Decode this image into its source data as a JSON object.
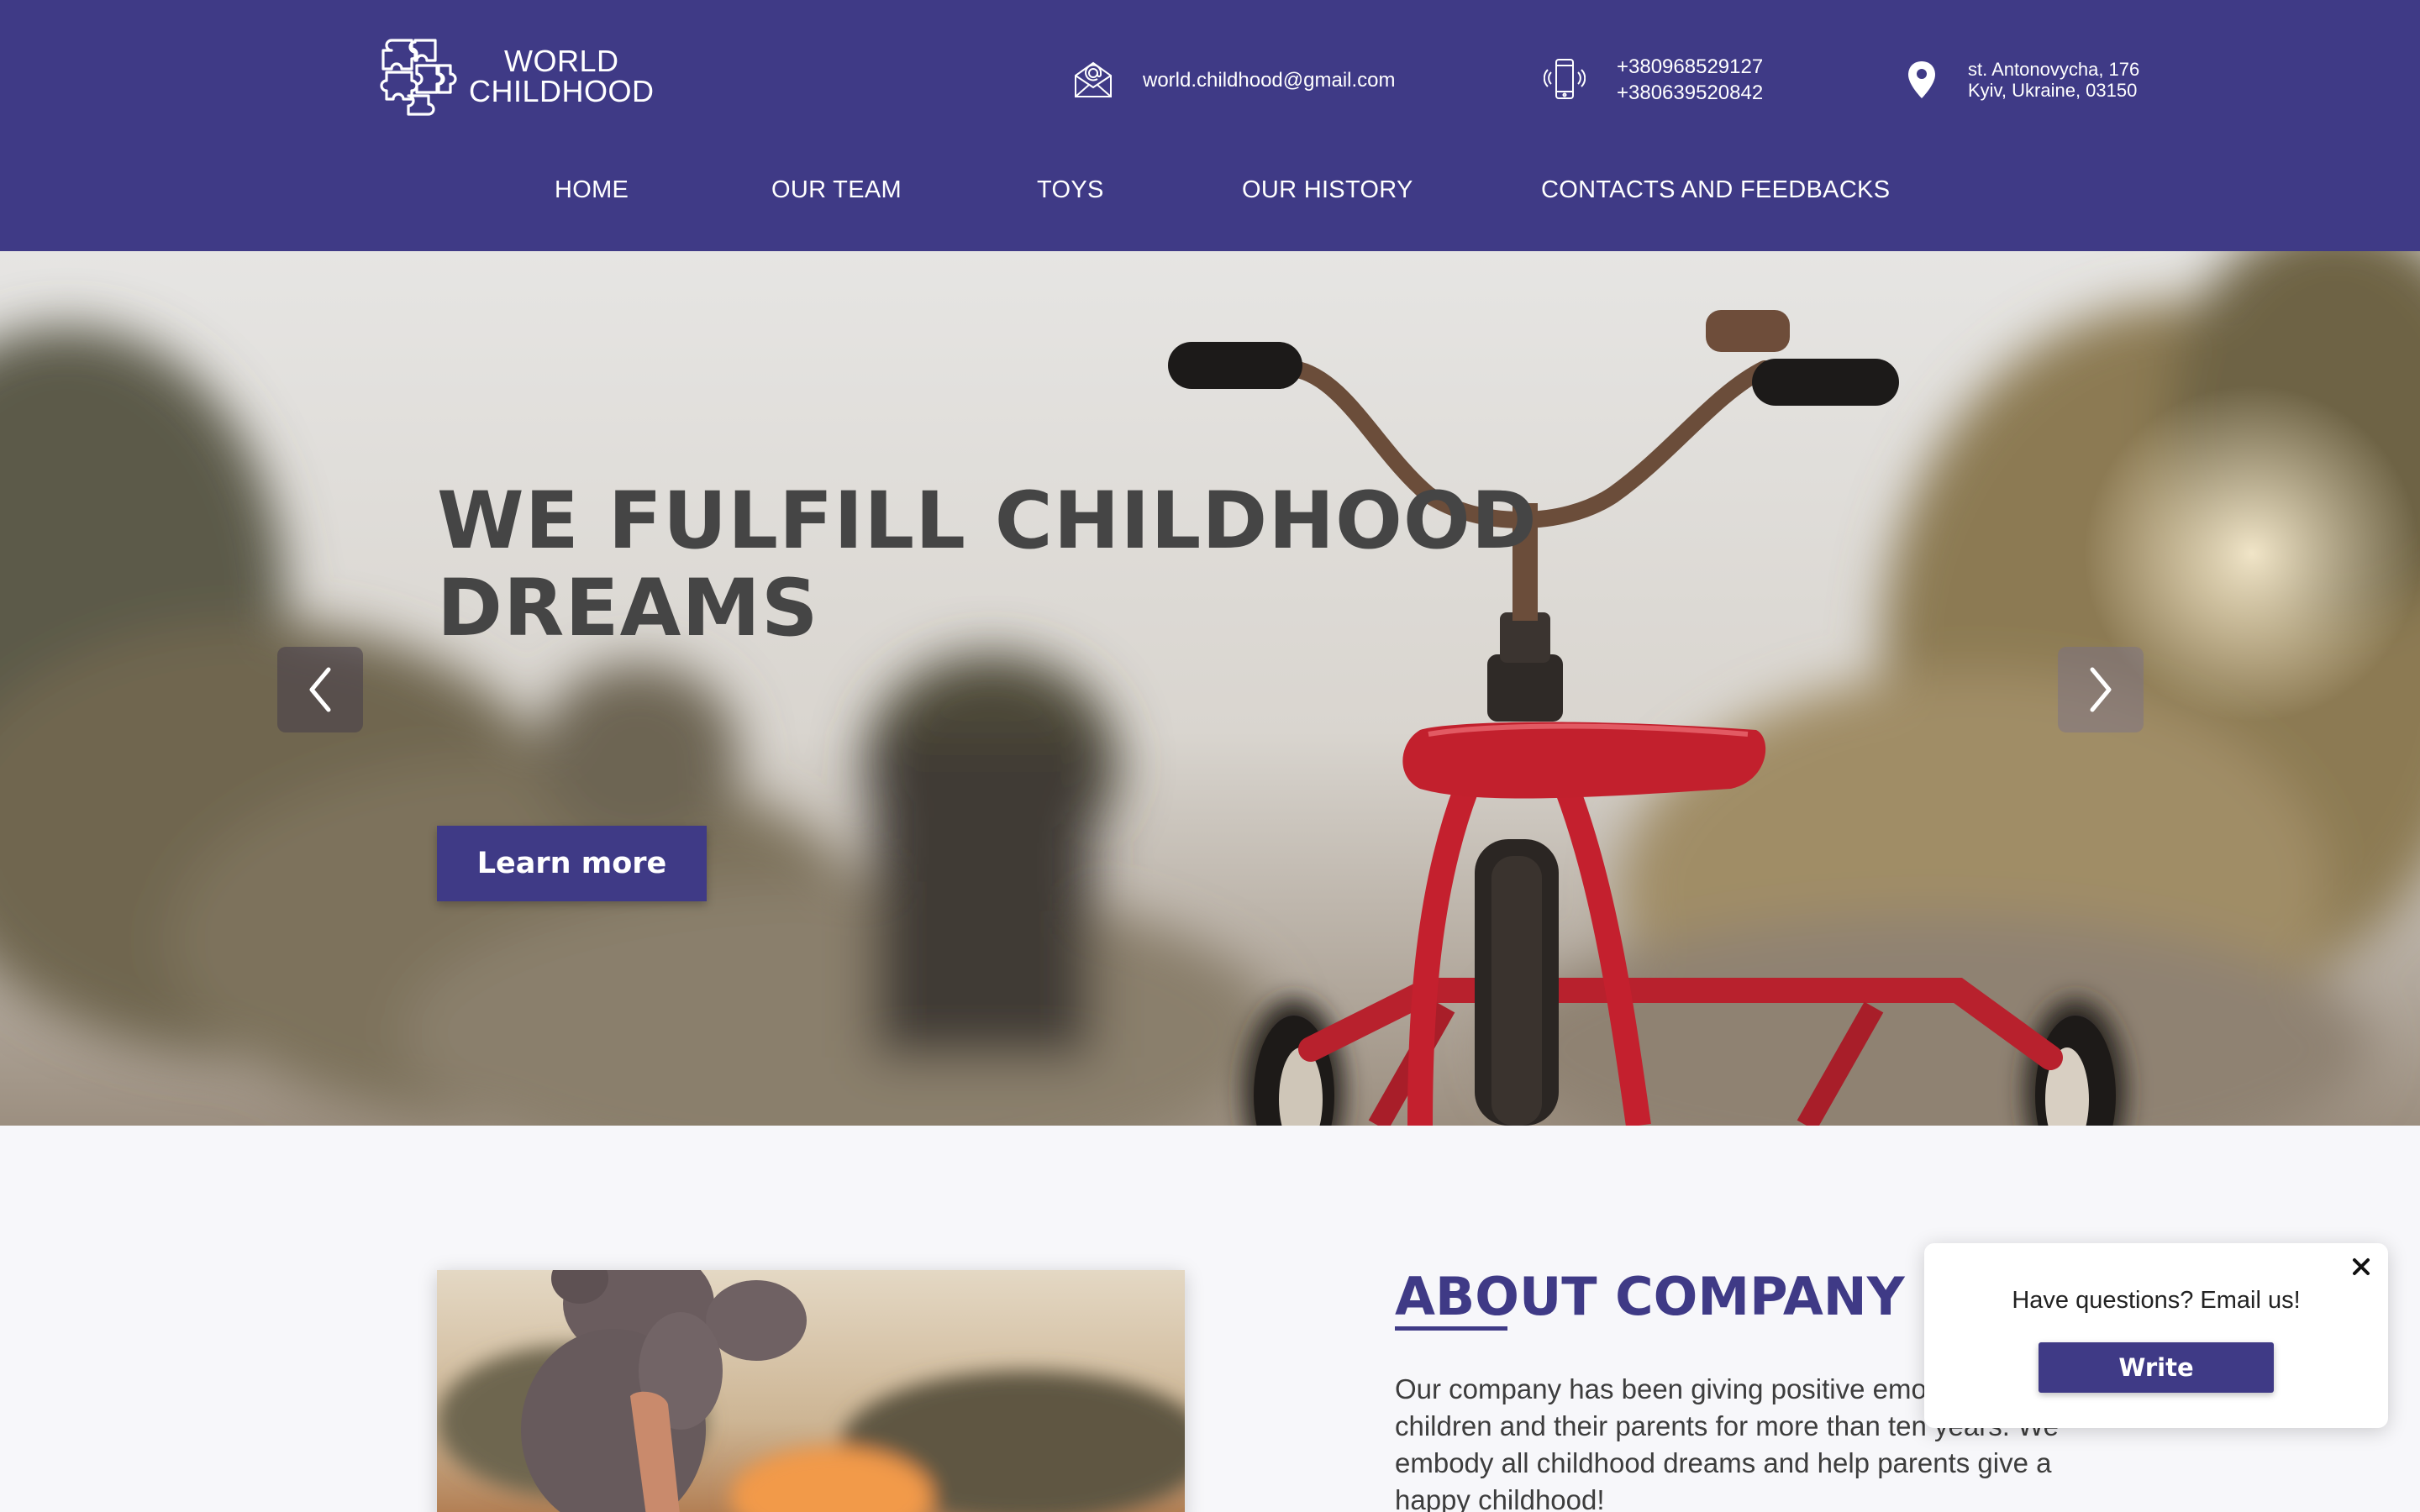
{
  "brand": {
    "line1": "WORLD",
    "line2": "CHILDHOOD",
    "color": "#3f3a86"
  },
  "header": {
    "email": "world.childhood@gmail.com",
    "phones": [
      "+380968529127",
      "+380639520842"
    ],
    "address": [
      "st. Antonovycha, 176",
      "Kyiv, Ukraine, 03150"
    ],
    "icons": {
      "email": "envelope-icon",
      "phone": "phone-icon",
      "address": "location-pin-icon"
    }
  },
  "nav": [
    {
      "label": "HOME"
    },
    {
      "label": "OUR TEAM"
    },
    {
      "label": "TOYS"
    },
    {
      "label": "OUR HISTORY"
    },
    {
      "label": "CONTACTS AND FEEDBACKS"
    }
  ],
  "hero": {
    "title_line1": "WE FULFILL CHILDHOOD",
    "title_line2": "DREAMS",
    "cta": "Learn more",
    "prev_icon": "chevron-left-icon",
    "next_icon": "chevron-right-icon"
  },
  "about": {
    "heading": "ABOUT COMPANY",
    "text": "Our company has been giving positive emotions to children and their parents for more than ten years. We embody all childhood dreams and help parents give a happy childhood!"
  },
  "popup": {
    "text": "Have questions? Email us!",
    "button": "Write",
    "close_icon": "close-icon"
  }
}
